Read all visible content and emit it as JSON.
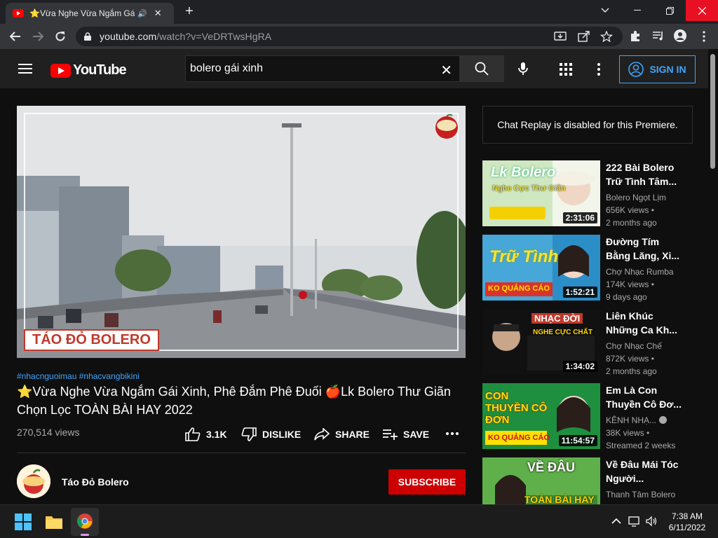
{
  "browser": {
    "tab_title": "⭐Vừa Nghe Vừa Ngắm Gái X",
    "url_host": "youtube.com",
    "url_path": "/watch?v=VeDRTwsHgRA"
  },
  "youtube": {
    "logo_text": "YouTube",
    "search_value": "bolero gái xinh",
    "signin_label": "SIGN IN"
  },
  "video": {
    "brand_overlay": "TÁO ĐỎ BOLERO",
    "hashtags": "#nhacnguoimau #nhacvangbikini",
    "title": "⭐Vừa Nghe Vừa Ngắm Gái Xinh, Phê Đắm Phê Đuối 🍎Lk Bolero Thư Giãn Chọn Lọc TOÀN BÀI HAY 2022",
    "views": "270,514 views",
    "like_count": "3.1K",
    "dislike_label": "DISLIKE",
    "share_label": "SHARE",
    "save_label": "SAVE",
    "channel_name": "Táo Đỏ Bolero",
    "subscribe_label": "SUBSCRIBE"
  },
  "sidebar": {
    "chat_replay": "Chat Replay is disabled for this Premiere.",
    "recommendations": [
      {
        "title": "222 Bài Bolero Trữ Tình Tâm...",
        "channel": "Bolero Ngọt Lịm",
        "views": "656K views •",
        "age": "2 months ago",
        "duration": "2:31:06",
        "thumb_text": "Lk Bolero",
        "thumb_sub": "Nghe Cực Thư Giãn",
        "accent": "#f5d000"
      },
      {
        "title": "Đường Tím Bằng Lăng, Xi...",
        "channel": "Chợ Nhạc Rumba",
        "views": "174K views •",
        "age": "9 days ago",
        "duration": "1:52:21",
        "thumb_text": "Trữ Tình",
        "thumb_sub": "KO QUẢNG CÁO",
        "accent": "#d9342b"
      },
      {
        "title": "Liên Khúc Những Ca Kh...",
        "channel": "Chợ Nhạc Chế",
        "views": "872K views •",
        "age": "2 months ago",
        "duration": "1:34:02",
        "thumb_text": "NHẠC ĐỜI",
        "thumb_sub": "NGHE CỰC CHẤT",
        "accent": "#ffd400"
      },
      {
        "title": "Em Là Con Thuyền Cô Đơ...",
        "channel": "KÊNH NHẠ...",
        "views": "38K views •",
        "age": "Streamed 2 weeks",
        "duration": "11:54:57",
        "thumb_text": "CON THUYỀN CÔ ĐƠN",
        "thumb_sub": "KO QUẢNG CÁO",
        "accent": "#ffe000"
      },
      {
        "title": "Về Đâu Mái Tóc Người...",
        "channel": "Thanh Tâm Bolero",
        "views": "",
        "age": "",
        "duration": "",
        "thumb_text": "VỀ ĐÂU",
        "thumb_sub": "TOÀN BÀI HAY",
        "accent": "#ffd400"
      }
    ]
  },
  "taskbar": {
    "time": "7:38 AM",
    "date": "6/11/2022"
  }
}
